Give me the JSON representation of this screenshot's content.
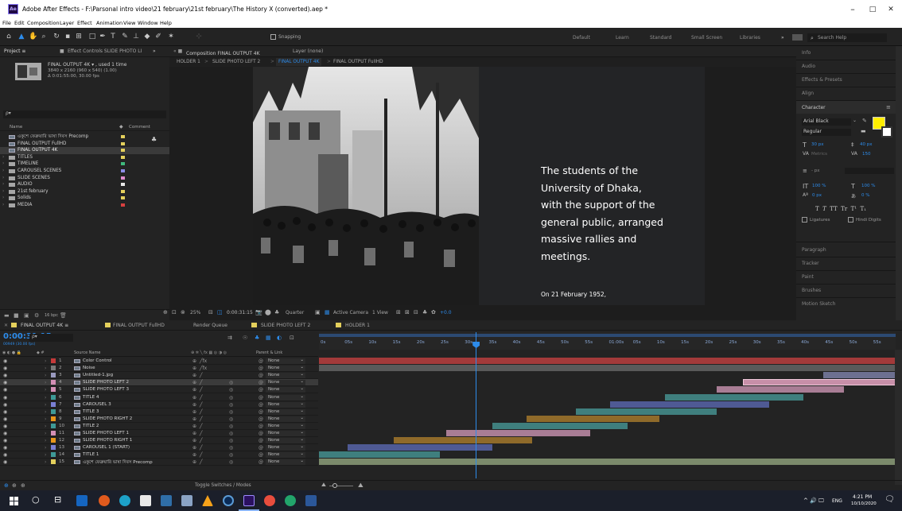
{
  "app": {
    "logo": "Ae",
    "title": "Adobe After Effects - F:\\Parsonal intro video\\21 february\\21st february\\The History X (converted).aep *",
    "min": "–",
    "max": "□",
    "close": "✕"
  },
  "menu": [
    "File",
    "Edit",
    "Composition",
    "Layer",
    "Effect",
    "Animation",
    "View",
    "Window",
    "Help"
  ],
  "toolbar": {
    "snapping": "Snapping",
    "workspaces": [
      "Default",
      "Learn",
      "Standard",
      "Small Screen",
      "Libraries"
    ],
    "search_placeholder": "Search Help",
    "more": "»"
  },
  "project": {
    "tab": "Project ≡",
    "effect_tab": "Effect Controls SLIDE PHOTO LI",
    "more": "»",
    "selected_name": "FINAL OUTPUT 4K ▾ , used 1 time",
    "selected_res": "3840 x 2160 (960 x 540) (1.00)",
    "selected_dur": "Δ 0:01:55:00, 30.00 fps",
    "search_placeholder": "ρ▾",
    "col_name": "Name",
    "col_comment": "Comment",
    "items": [
      {
        "name": "একুশে ফেব্রুয়ারি ভাষা দিবস Precomp",
        "color": "#e4d05c",
        "type": "comp"
      },
      {
        "name": "FINAL OUTPUT FullHD",
        "color": "#e4d05c",
        "type": "comp"
      },
      {
        "name": "FINAL OUTPUT 4K",
        "color": "#e4d05c",
        "type": "comp",
        "selected": true
      },
      {
        "name": "TITLES",
        "color": "#e4d05c",
        "type": "folder"
      },
      {
        "name": "TIMELINE",
        "color": "#3fb97d",
        "type": "folder"
      },
      {
        "name": "CAROUSEL SCENES",
        "color": "#8c8ce6",
        "type": "folder"
      },
      {
        "name": "SLIDE SCENES",
        "color": "#e08ccd",
        "type": "folder"
      },
      {
        "name": "AUDIO",
        "color": "#e8e8e8",
        "type": "folder"
      },
      {
        "name": "21st february",
        "color": "#e4d05c",
        "type": "folder"
      },
      {
        "name": "Solids",
        "color": "#e4d05c",
        "type": "folder"
      },
      {
        "name": "MEDIA",
        "color": "#d74040",
        "type": "folder"
      }
    ],
    "bpc": "16 bpc"
  },
  "viewer": {
    "comp_tab": "Composition FINAL OUTPUT 4K",
    "layer_tab": "Layer (none)",
    "breadcrumbs": [
      "HOLDER 1",
      "SLIDE PHOTO LEFT 2",
      "FINAL OUTPUT 4K",
      "FINAL OUTPUT FullHD"
    ],
    "caption": [
      "The students of the",
      "University of Dhaka,",
      "with the support of the",
      "general public, arranged",
      "massive rallies and",
      "meetings."
    ],
    "subcaption": "On 21 February 1952,",
    "zoom": "25%",
    "timecode": "0:00:31:15",
    "resolution": "Quarter",
    "camera": "Active Camera",
    "views": "1 View",
    "exposure": "+0.0"
  },
  "right": {
    "sections": [
      "Info",
      "Audio",
      "Effects & Presets",
      "Align",
      "Character"
    ],
    "font": "Arial Black",
    "style": "Regular",
    "size": "30 px",
    "leading": "40 px",
    "kerning": "Metrics",
    "tracking": "150",
    "indent": "- px",
    "vscale": "100 %",
    "hscale": "100 %",
    "baseline": "0 px",
    "tsume": "0 %",
    "ligatures": "Ligatures",
    "hindi": "Hindi Digits",
    "bottom": [
      "Paragraph",
      "Tracker",
      "Paint",
      "Brushes",
      "Motion Sketch"
    ],
    "fill": "#ffee00"
  },
  "timeline": {
    "tabs": [
      "FINAL OUTPUT 4K ≡",
      "FINAL OUTPUT FullHD",
      "Render Queue",
      "SLIDE PHOTO LEFT 2",
      "HOLDER 1"
    ],
    "timecode": "0:00:31:15",
    "frames": "00949 (30.00 fps)",
    "search_placeholder": "ρ▾",
    "col_source": "Source Name",
    "col_parent": "Parent & Link",
    "ruler": [
      "0s",
      "05s",
      "10s",
      "15s",
      "20s",
      "25s",
      "30s",
      "35s",
      "40s",
      "45s",
      "50s",
      "55s",
      "01:00s",
      "05s",
      "10s",
      "15s",
      "20s",
      "25s",
      "30s",
      "35s",
      "40s",
      "45s",
      "50s",
      "55s"
    ],
    "layers": [
      {
        "n": "1",
        "name": "Color Control",
        "color": "#c63a3a",
        "parent": "None",
        "bar": {
          "s": 0,
          "e": 1,
          "c": "#a33a3a"
        }
      },
      {
        "n": "2",
        "name": "Noise",
        "color": "#7a7a7a",
        "parent": "None",
        "bar": {
          "s": 0,
          "e": 1,
          "c": "#5a5a5a"
        }
      },
      {
        "n": "3",
        "name": "Untitled-1.jpg",
        "color": "#9a9abf",
        "parent": "None",
        "bar": {
          "s": 0.874,
          "e": 1,
          "c": "#6d7090"
        }
      },
      {
        "n": "4",
        "name": "SLIDE PHOTO LEFT 2",
        "color": "#d48fb5",
        "parent": "None",
        "bar": {
          "s": 0.735,
          "e": 1,
          "c": "#c78fa8",
          "sel": true
        }
      },
      {
        "n": "5",
        "name": "SLIDE PHOTO LEFT 3",
        "color": "#d48fb5",
        "parent": "None",
        "bar": {
          "s": 0.69,
          "e": 0.91,
          "c": "#a97d95"
        }
      },
      {
        "n": "6",
        "name": "TITLE 4",
        "color": "#3e9a97",
        "parent": "None",
        "bar": {
          "s": 0.6,
          "e": 0.84,
          "c": "#3f7f7e"
        }
      },
      {
        "n": "7",
        "name": "CAROUSEL 3",
        "color": "#7a80d4",
        "parent": "None",
        "bar": {
          "s": 0.505,
          "e": 0.78,
          "c": "#4f5a94"
        }
      },
      {
        "n": "8",
        "name": "TITLE 3",
        "color": "#3e9a97",
        "parent": "None",
        "bar": {
          "s": 0.445,
          "e": 0.69,
          "c": "#3f7f7e"
        }
      },
      {
        "n": "9",
        "name": "SLIDE PHOTO RIGHT 2",
        "color": "#e8961a",
        "parent": "None",
        "bar": {
          "s": 0.36,
          "e": 0.59,
          "c": "#8f6a2a"
        }
      },
      {
        "n": "10",
        "name": "TITLE 2",
        "color": "#3e9a97",
        "parent": "None",
        "bar": {
          "s": 0.3,
          "e": 0.535,
          "c": "#3f7f7e"
        }
      },
      {
        "n": "11",
        "name": "SLIDE PHOTO LEFT 1",
        "color": "#d48fb5",
        "parent": "None",
        "bar": {
          "s": 0.22,
          "e": 0.47,
          "c": "#a97d95"
        }
      },
      {
        "n": "12",
        "name": "SLIDE PHOTO RIGHT 1",
        "color": "#e8961a",
        "parent": "None",
        "bar": {
          "s": 0.13,
          "e": 0.37,
          "c": "#8f6a2a"
        }
      },
      {
        "n": "13",
        "name": "CAROUSEL 1 (START)",
        "color": "#7a80d4",
        "parent": "None",
        "bar": {
          "s": 0.05,
          "e": 0.3,
          "c": "#4f5a94"
        }
      },
      {
        "n": "14",
        "name": "TITLE 1",
        "color": "#3e9a97",
        "parent": "None",
        "bar": {
          "s": 0,
          "e": 0.21,
          "c": "#3f7f7e"
        }
      },
      {
        "n": "15",
        "name": "একুশে ফেব্রুয়ারি ভাষা দিবস Precomp",
        "color": "#e4d05c",
        "parent": "None",
        "bar": {
          "s": 0,
          "e": 1,
          "c": "#7b8a6b"
        }
      }
    ],
    "playhead": 0.272,
    "toggle": "Toggle Switches / Modes"
  },
  "taskbar": {
    "time": "4:21 PM",
    "date": "10/10/2020",
    "lang": "ENG"
  }
}
